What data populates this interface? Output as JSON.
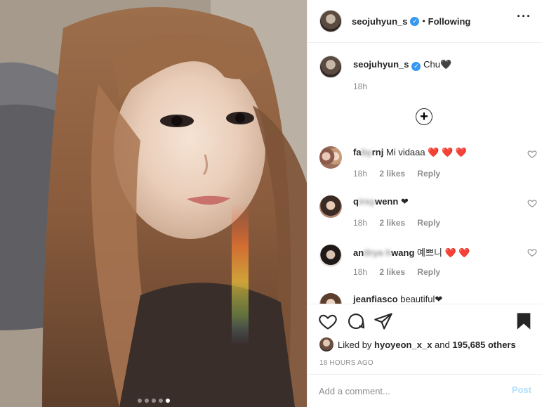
{
  "post": {
    "owner": "seojuhyun_s",
    "follow_status": "Following",
    "separator": "•",
    "caption_text": "Chu🖤",
    "caption_time": "18h"
  },
  "photo": {
    "carousel_count": 5,
    "active_index": 4
  },
  "comments": [
    {
      "user_visible_start": "fa",
      "user_blurred": "by",
      "user_visible_end": "rnj",
      "text": "Mi vidaaa",
      "hearts": "❤️ ❤️ ❤️",
      "time": "18h",
      "likes": "2 likes",
      "reply": "Reply"
    },
    {
      "user_visible_start": "q",
      "user_blurred": "irsy",
      "user_visible_end": "wenn",
      "text": "❤",
      "hearts": "",
      "time": "18h",
      "likes": "2 likes",
      "reply": "Reply"
    },
    {
      "user_visible_start": "an",
      "user_blurred": "tlrya h",
      "user_visible_end": "wang",
      "text": "예쁘니",
      "hearts": "❤️ ❤️",
      "time": "18h",
      "likes": "2 likes",
      "reply": "Reply"
    },
    {
      "user_visible_start": "jeanfiasco",
      "user_blurred": "",
      "user_visible_end": "",
      "text": "beautiful❤",
      "hearts": "",
      "time": "",
      "likes": "",
      "reply": ""
    }
  ],
  "likes": {
    "prefix": "Liked by",
    "user": "hyoyeon_x_x",
    "and": "and",
    "count": "195,685 others"
  },
  "timestamp": "18 HOURS AGO",
  "composer": {
    "placeholder": "Add a comment...",
    "post_label": "Post"
  },
  "icons": [
    "heart-icon",
    "comment-icon",
    "share-icon",
    "bookmark-icon",
    "more-icon",
    "verified-icon",
    "load-more-icon"
  ],
  "colors": {
    "verified": "#3897f0",
    "post_disabled": "#b2dffc",
    "heart_red": "#e0245e",
    "muted_text": "#8e8e8e"
  }
}
